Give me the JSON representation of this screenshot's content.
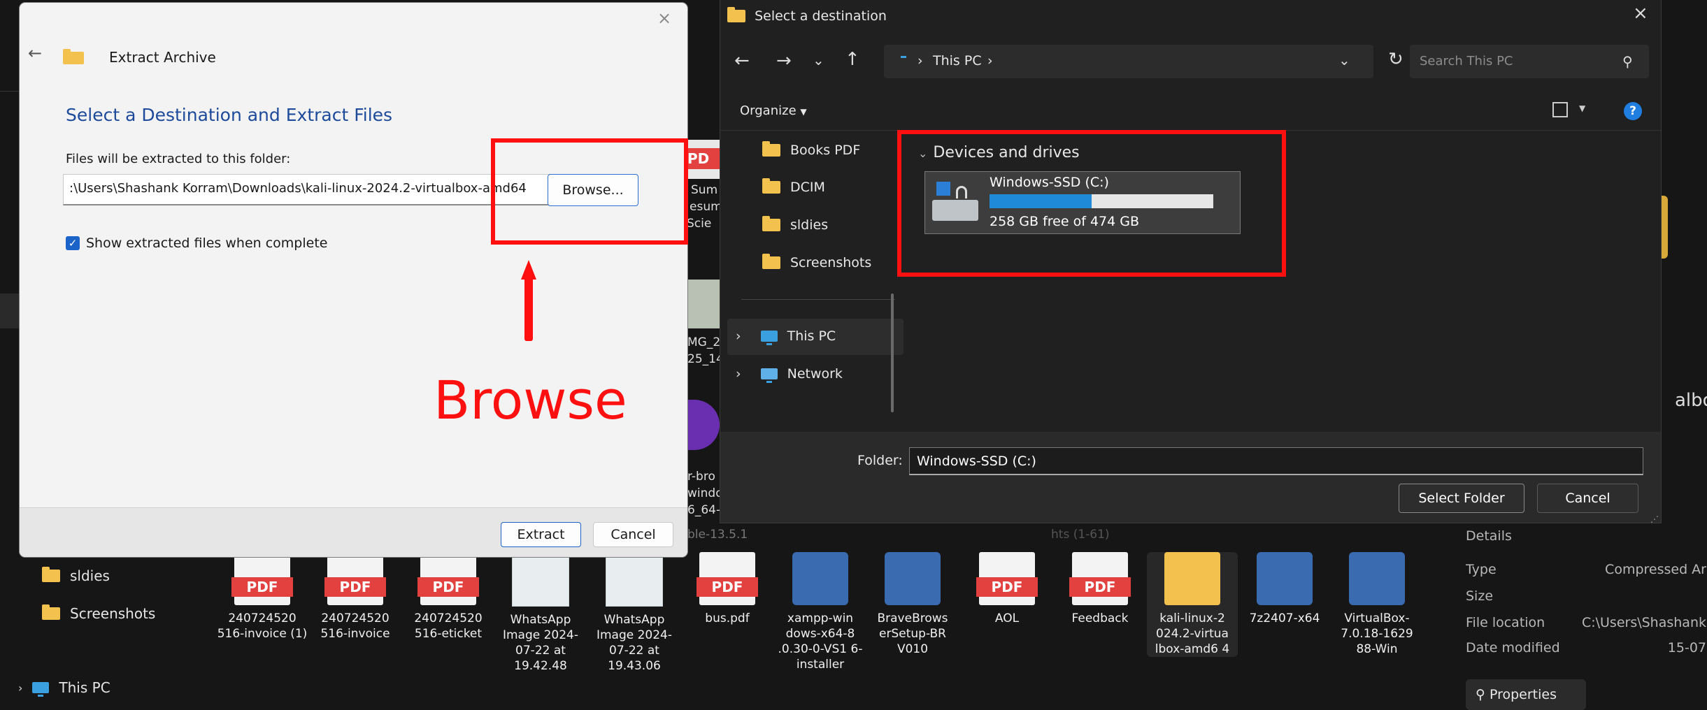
{
  "background": {
    "left_nav": [
      {
        "label": "sldies",
        "icon": "folder-icon"
      },
      {
        "label": "Screenshots",
        "icon": "folder-icon"
      },
      {
        "label": "This PC",
        "icon": "pc-icon"
      }
    ],
    "partial_labels": {
      "pdf_fragment": "PD",
      "sum": "Sum",
      "esum": "esum",
      "scie": "Scie",
      "mg2": "MG_2",
      "t25_14": "25_14",
      "rbro": "r-bro",
      "windo": "windo",
      "s64": "6_64-",
      "ble": "ble-13.5.1",
      "hts": "hts (1-61)",
      "albo": "albo"
    },
    "files": [
      {
        "label": "240724520 516-invoice (1)",
        "type": "pdf"
      },
      {
        "label": "240724520 516-invoice",
        "type": "pdf"
      },
      {
        "label": "240724520 516-eticket",
        "type": "pdf"
      },
      {
        "label": "WhatsApp Image 2024-07-22 at 19.42.48",
        "type": "image"
      },
      {
        "label": "WhatsApp Image 2024-07-22 at 19.43.06",
        "type": "image"
      },
      {
        "label": "bus.pdf",
        "type": "pdf"
      },
      {
        "label": "xampp-win dows-x64-8 .0.30-0-VS1 6-installer",
        "type": "app"
      },
      {
        "label": "BraveBrows erSetup-BR V010",
        "type": "app"
      },
      {
        "label": "AOL",
        "type": "pdf"
      },
      {
        "label": "Feedback",
        "type": "pdf"
      },
      {
        "label": "kali-linux-2 024.2-virtua lbox-amd6 4",
        "type": "zip"
      },
      {
        "label": "7z2407-x64",
        "type": "app"
      },
      {
        "label": "VirtualBox- 7.0.18-1629 88-Win",
        "type": "app"
      }
    ],
    "pdf_tag": "PDF",
    "details": {
      "heading": "Details",
      "rows": [
        {
          "key": "Type",
          "value": "Compressed Ar"
        },
        {
          "key": "Size",
          "value": ""
        },
        {
          "key": "File location",
          "value": "C:\\Users\\Shashank"
        },
        {
          "key": "Date modified",
          "value": "15-07"
        }
      ],
      "properties": "Properties"
    }
  },
  "extract_dialog": {
    "title": "Extract Archive",
    "heading": "Select a Destination and Extract Files",
    "folder_label": "Files will be extracted to this folder:",
    "path_value": ":\\Users\\Shashank Korram\\Downloads\\kali-linux-2024.2-virtualbox-amd64",
    "browse": "Browse...",
    "checkbox_label": "Show extracted files when complete",
    "checkbox_checked": true,
    "extract": "Extract",
    "cancel": "Cancel"
  },
  "dest_dialog": {
    "title": "Select a destination",
    "address": [
      "This PC"
    ],
    "search_placeholder": "Search This PC",
    "organize": "Organize",
    "nav": [
      {
        "label": "Books PDF",
        "icon": "folder-icon"
      },
      {
        "label": "DCIM",
        "icon": "folder-icon"
      },
      {
        "label": "sldies",
        "icon": "folder-icon"
      },
      {
        "label": "Screenshots",
        "icon": "folder-icon"
      },
      {
        "label": "This PC",
        "icon": "pc-icon"
      },
      {
        "label": "Network",
        "icon": "network-icon"
      }
    ],
    "section": "Devices and drives",
    "drive": {
      "name": "Windows-SSD (C:)",
      "free": "258 GB free of 474 GB",
      "used_fraction": 0.456
    },
    "folder_label": "Folder:",
    "folder_value": "Windows-SSD (C:)",
    "select_folder": "Select Folder",
    "cancel": "Cancel"
  },
  "annotation": {
    "label": "Browse",
    "color": "#ff1010"
  }
}
